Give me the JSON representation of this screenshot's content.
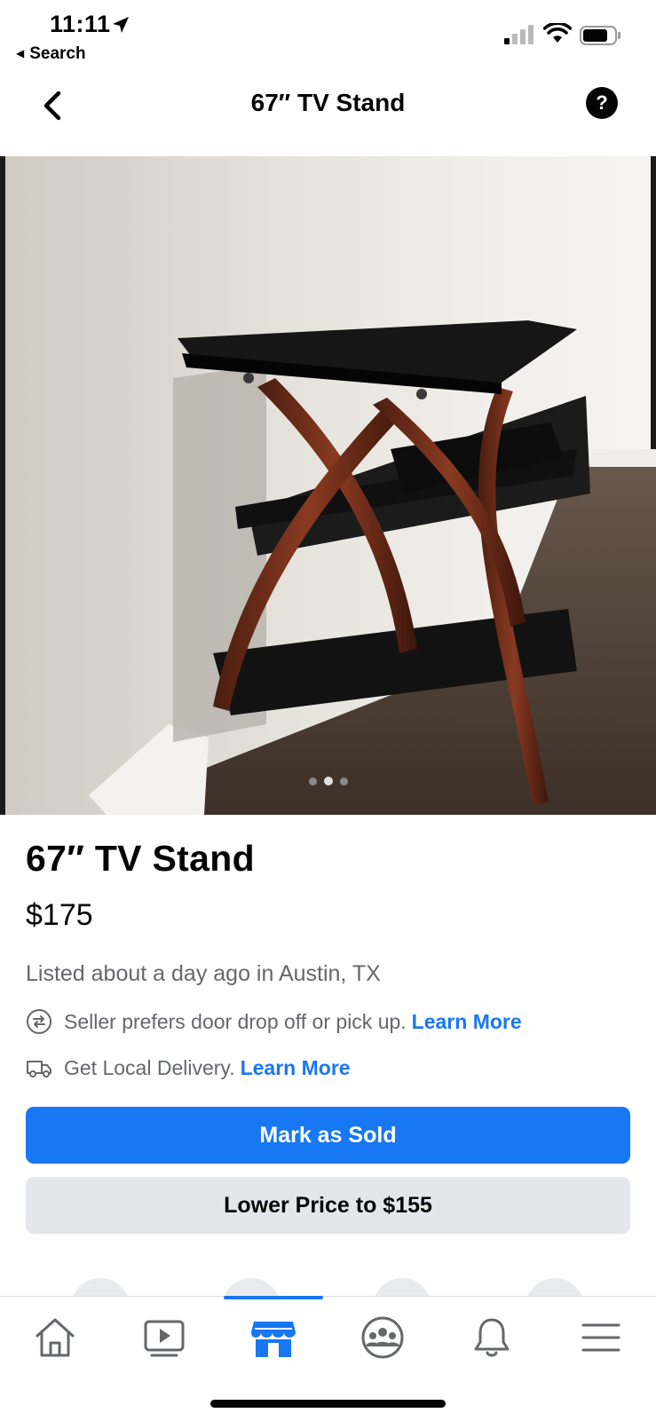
{
  "status_bar": {
    "time": "11:11",
    "back_app": "Search"
  },
  "nav": {
    "title": "67″ TV Stand",
    "help_label": "?"
  },
  "listing": {
    "title": "67″ TV Stand",
    "price": "$175",
    "listed_text": "Listed about a day ago in Austin, TX",
    "pickup_text": "Seller prefers door drop off or pick up.",
    "pickup_link": "Learn More",
    "delivery_text": "Get Local Delivery.",
    "delivery_link": "Learn More",
    "photo_count": 3,
    "photo_active_index": 2
  },
  "actions": {
    "mark_sold": "Mark as Sold",
    "lower_price": "Lower Price to $155"
  },
  "tab_bar": {
    "items": [
      "home-icon",
      "video-icon",
      "marketplace-icon",
      "groups-icon",
      "notifications-icon",
      "menu-icon"
    ],
    "active": "marketplace-icon"
  },
  "colors": {
    "accent": "#1877f2",
    "secondary_button": "#e4e6eb",
    "muted_text": "#65676b"
  }
}
